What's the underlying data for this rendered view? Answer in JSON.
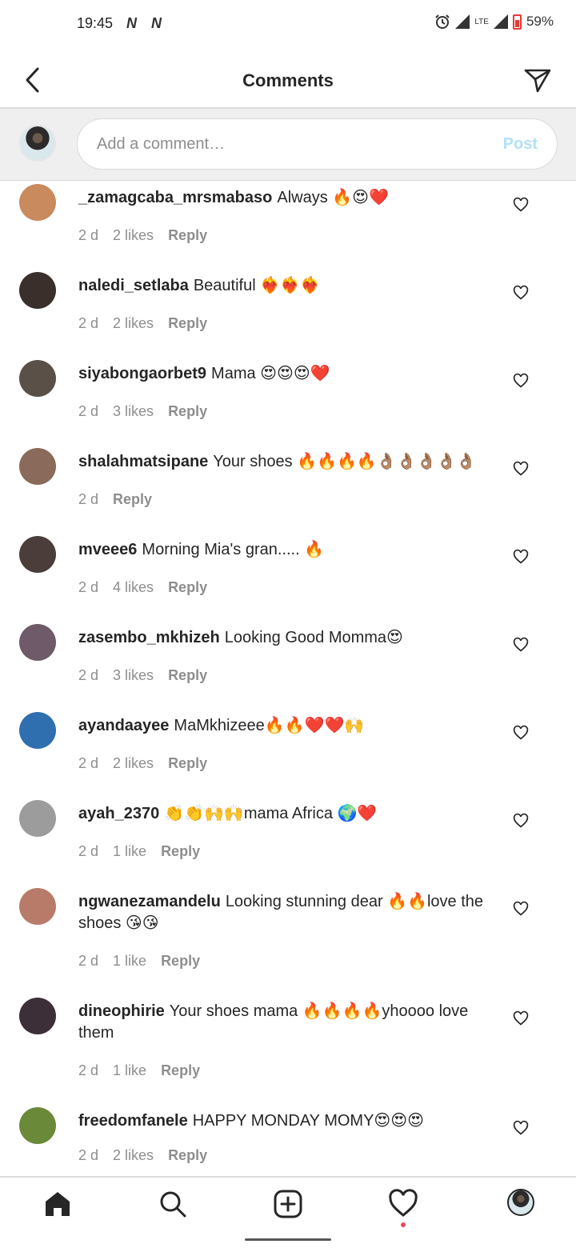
{
  "status_bar": {
    "time": "19:45",
    "carrier_marks": [
      "N",
      "N"
    ],
    "network": "LTE",
    "battery": "59%"
  },
  "header": {
    "title": "Comments"
  },
  "composer": {
    "placeholder": "Add a comment…",
    "post_label": "Post"
  },
  "comments": [
    {
      "user": "_zamagcaba_mrsmabaso",
      "text": "Always 🔥😍❤️",
      "age": "2 d",
      "likes": "2 likes",
      "reply": "Reply",
      "avatar_color": "#c98a5e"
    },
    {
      "user": "naledi_setlaba",
      "text": "Beautiful ❤️‍🔥❤️‍🔥❤️‍🔥",
      "age": "2 d",
      "likes": "2 likes",
      "reply": "Reply",
      "avatar_color": "#3a2f2b"
    },
    {
      "user": "siyabongaorbet9",
      "text": "Mama 😍😍😍❤️",
      "age": "2 d",
      "likes": "3 likes",
      "reply": "Reply",
      "avatar_color": "#5a5048"
    },
    {
      "user": "shalahmatsipane",
      "text": "Your shoes 🔥🔥🔥🔥👌🏽👌🏽👌🏽👌🏽👌🏽",
      "age": "2 d",
      "likes": "",
      "reply": "Reply",
      "avatar_color": "#8a6a5a"
    },
    {
      "user": "mveee6",
      "text": "Morning Mia's gran..... 🔥",
      "age": "2 d",
      "likes": "4 likes",
      "reply": "Reply",
      "avatar_color": "#4a3d3a"
    },
    {
      "user": "zasembo_mkhizeh",
      "text": "Looking Good Momma😍",
      "age": "2 d",
      "likes": "3 likes",
      "reply": "Reply",
      "avatar_color": "#6e5a68"
    },
    {
      "user": "ayandaayee",
      "text": "MaMkhizeee🔥🔥❤️❤️🙌",
      "age": "2 d",
      "likes": "2 likes",
      "reply": "Reply",
      "avatar_color": "#2f6fb0"
    },
    {
      "user": "ayah_2370",
      "text": "👏👏🙌🙌mama Africa 🌍❤️",
      "age": "2 d",
      "likes": "1 like",
      "reply": "Reply",
      "avatar_color": "#9c9c9c"
    },
    {
      "user": "ngwanezamandelu",
      "text": "Looking stunning dear 🔥🔥love the shoes 😘😘",
      "age": "2 d",
      "likes": "1 like",
      "reply": "Reply",
      "avatar_color": "#b87b6a"
    },
    {
      "user": "dineophirie",
      "text": "Your shoes mama 🔥🔥🔥🔥yhoooo love them",
      "age": "2 d",
      "likes": "1 like",
      "reply": "Reply",
      "avatar_color": "#3c2f38"
    },
    {
      "user": "freedomfanele",
      "text": "HAPPY MONDAY MOMY😍😍😍",
      "age": "2 d",
      "likes": "2 likes",
      "reply": "Reply",
      "avatar_color": "#6a8a3a"
    }
  ],
  "bottom_nav": {
    "items": [
      "home-icon",
      "search-icon",
      "new-post-icon",
      "activity-heart-icon",
      "profile-avatar"
    ],
    "notification_color": "#ed4956"
  },
  "colors": {
    "post_disabled": "#b2dffc",
    "meta_gray": "#8e8e8e",
    "text": "#262626"
  }
}
